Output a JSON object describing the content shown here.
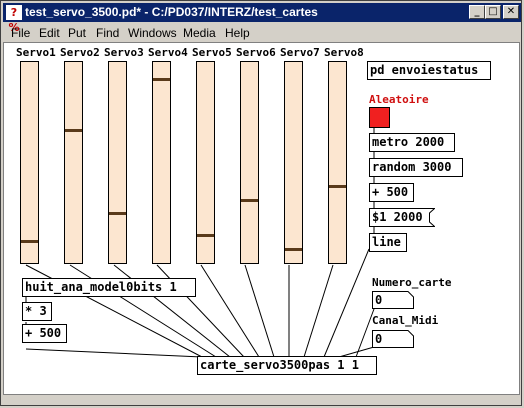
{
  "window": {
    "title": "test_servo_3500.pd* - C:/PD037/INTERZ/test_cartes",
    "app_icon": "pd-icon",
    "controls": {
      "minimize": "_",
      "maximize": "□",
      "close": "✕"
    }
  },
  "menu": [
    "File",
    "Edit",
    "Put",
    "Find",
    "Windows",
    "Media",
    "Help"
  ],
  "patch": {
    "servos": [
      {
        "label": "Servo1",
        "level": 0.1
      },
      {
        "label": "Servo2",
        "level": 0.66
      },
      {
        "label": "Servo3",
        "level": 0.24
      },
      {
        "label": "Servo4",
        "level": 0.92
      },
      {
        "label": "Servo5",
        "level": 0.13
      },
      {
        "label": "Servo6",
        "level": 0.31
      },
      {
        "label": "Servo7",
        "level": 0.06
      },
      {
        "label": "Servo8",
        "level": 0.38
      }
    ],
    "objects": {
      "pd_envoi": "pd envoiestatus",
      "aleatoire_label": "Aleatoire",
      "metro": "metro 2000",
      "random": "random 3000",
      "plus500_right": "+ 500",
      "msg_dollar": "$1 2000",
      "line": "line",
      "huit_ana": "huit_ana_model0bits 1",
      "times3": "* 3",
      "plus500_left": "+ 500",
      "carte": "carte_servo3500pas 1 1",
      "numero_carte_label": "Numero_carte",
      "numero_carte_value": "0",
      "canal_midi_label": "Canal_Midi",
      "canal_midi_value": "0"
    },
    "colors": {
      "slider_bg": "#fce6d0",
      "bang": "#f02020",
      "aleatoire": "#d01010",
      "titlebar": "#0a246a"
    }
  }
}
